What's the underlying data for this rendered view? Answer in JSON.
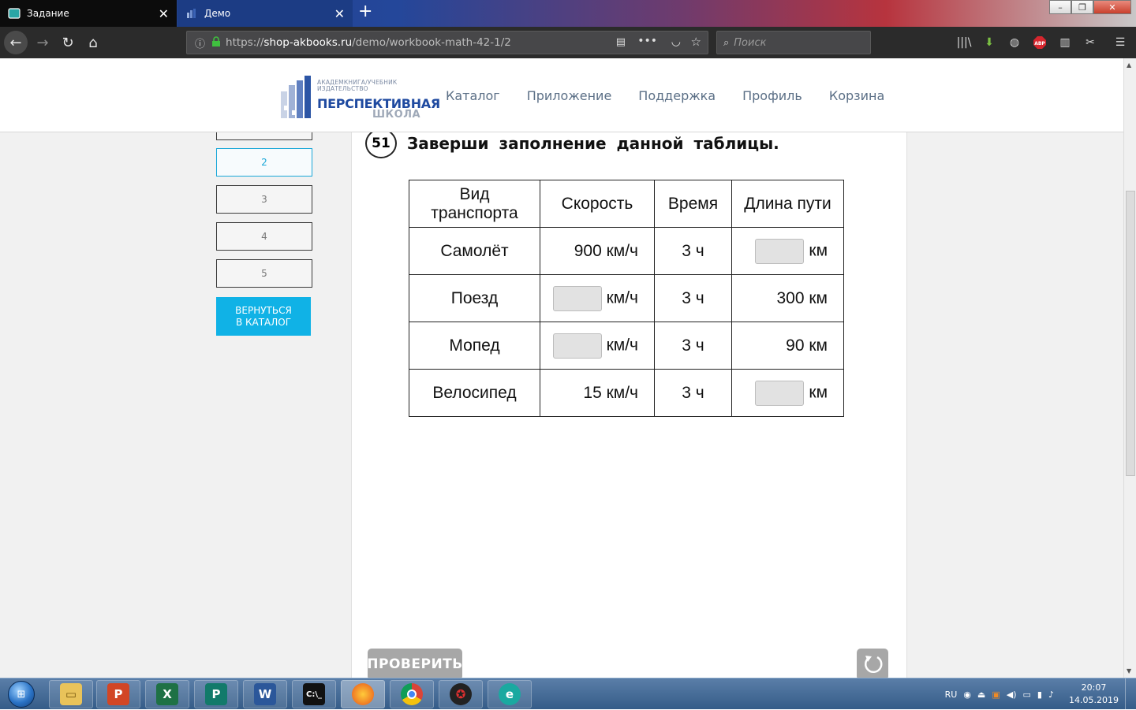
{
  "browser": {
    "tabs": [
      {
        "label": "Задание"
      },
      {
        "label": "Демо"
      }
    ],
    "url": {
      "prefix": "https://",
      "host": "shop-akbooks.ru",
      "path": "/demo/workbook-math-42-1/2"
    },
    "search_placeholder": "Поиск"
  },
  "site": {
    "logo": {
      "top_line1": "АКАДЕМКНИГА/УЧЕБНИК",
      "top_line2": "ИЗДАТЕЛЬСТВО",
      "main": "ПЕРСПЕКТИВНАЯ",
      "sub": "ШКОЛА"
    },
    "nav": [
      "Каталог",
      "Приложение",
      "Поддержка",
      "Профиль",
      "Корзина"
    ]
  },
  "sidebar": {
    "pages": [
      "2",
      "3",
      "4",
      "5"
    ],
    "active_page": "2",
    "back_button_line1": "ВЕРНУТЬСЯ",
    "back_button_line2": "В КАТАЛОГ"
  },
  "task": {
    "number": "51",
    "title": "Заверши заполнение данной таблицы.",
    "headers": [
      "Вид транспорта",
      "Скорость",
      "Время",
      "Длина пути"
    ],
    "header_vid": "Вид",
    "header_transport": "транспорта",
    "rows": [
      {
        "vehicle": "Самолёт",
        "speed": "900 км/ч",
        "time": "3 ч",
        "distance_unit": "км"
      },
      {
        "vehicle": "Поезд",
        "speed_unit": "км/ч",
        "time": "3 ч",
        "distance": "300 км"
      },
      {
        "vehicle": "Мопед",
        "speed_unit": "км/ч",
        "time": "3 ч",
        "distance": "90 км"
      },
      {
        "vehicle": "Велосипед",
        "speed": "15 км/ч",
        "time": "3 ч",
        "distance_unit": "км"
      }
    ],
    "check_button": "ПРОВЕРИТЬ"
  },
  "taskbar": {
    "language": "RU",
    "time": "20:07",
    "date": "14.05.2019"
  }
}
